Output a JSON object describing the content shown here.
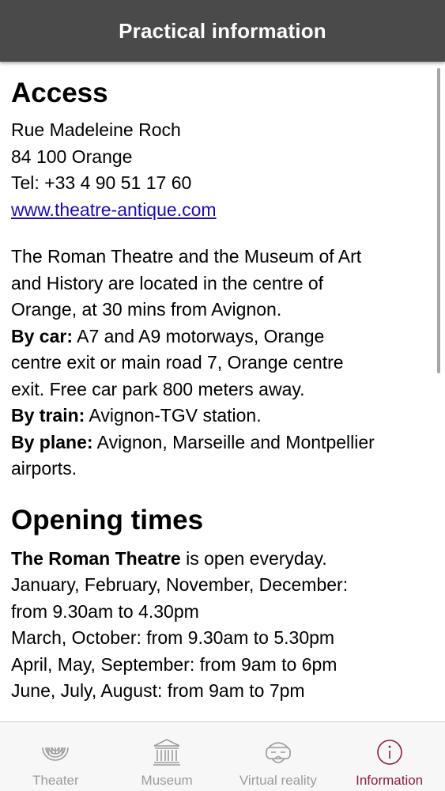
{
  "header": {
    "title": "Practical information"
  },
  "access": {
    "heading": "Access",
    "address_street": "Rue Madeleine Roch",
    "address_city": "84 100 Orange",
    "phone": "Tel: +33 4 90 51 17 60",
    "website": "www.theatre-antique.com",
    "intro_lines": [
      "The Roman Theatre and the Museum of Art",
      "and History are located in the centre of",
      "Orange, at 30 mins from Avignon."
    ],
    "by_car_label": "By car:",
    "by_car_lines": [
      " A7 and A9 motorways, Orange",
      "centre exit or main road 7, Orange centre",
      "exit. Free car park 800 meters away."
    ],
    "by_train_label": "By train:",
    "by_train_text": " Avignon-TGV station.",
    "by_plane_label": "By plane:",
    "by_plane_lines": [
      " Avignon, Marseille and Montpellier",
      "airports."
    ]
  },
  "opening": {
    "heading": "Opening times",
    "theatre_label": "The Roman Theatre",
    "theatre_text": " is open everyday.",
    "lines": [
      "January, February, November, December:",
      "from 9.30am to 4.30pm",
      "March, October: from 9.30am to 5.30pm",
      "April, May, September: from 9am to 6pm",
      "June, July, August: from 9am to 7pm"
    ]
  },
  "tabbar": {
    "tabs": [
      {
        "label": "Theater",
        "icon": "theater-icon"
      },
      {
        "label": "Museum",
        "icon": "museum-icon"
      },
      {
        "label": "Virtual reality",
        "icon": "vr-headset-icon"
      },
      {
        "label": "Information",
        "icon": "info-icon"
      }
    ],
    "active_index": 3
  },
  "colors": {
    "header_bg": "#4a4a4a",
    "link": "#1a0dab",
    "tab_active": "#8c1d3a",
    "tab_inactive": "#9b9b9b"
  }
}
